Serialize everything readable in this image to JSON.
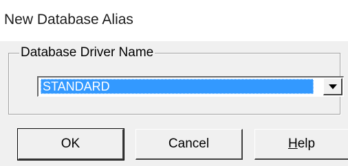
{
  "window": {
    "title": "New Database Alias"
  },
  "group": {
    "label": "Database Driver Name"
  },
  "driver_select": {
    "selected": "STANDARD",
    "arrow_icon": "chevron-down-icon"
  },
  "buttons": {
    "ok": "OK",
    "cancel": "Cancel",
    "help_mnemonic": "H",
    "help_rest": "elp"
  },
  "colors": {
    "selection": "#3399ff",
    "dialog_face": "#f0f0f0"
  }
}
